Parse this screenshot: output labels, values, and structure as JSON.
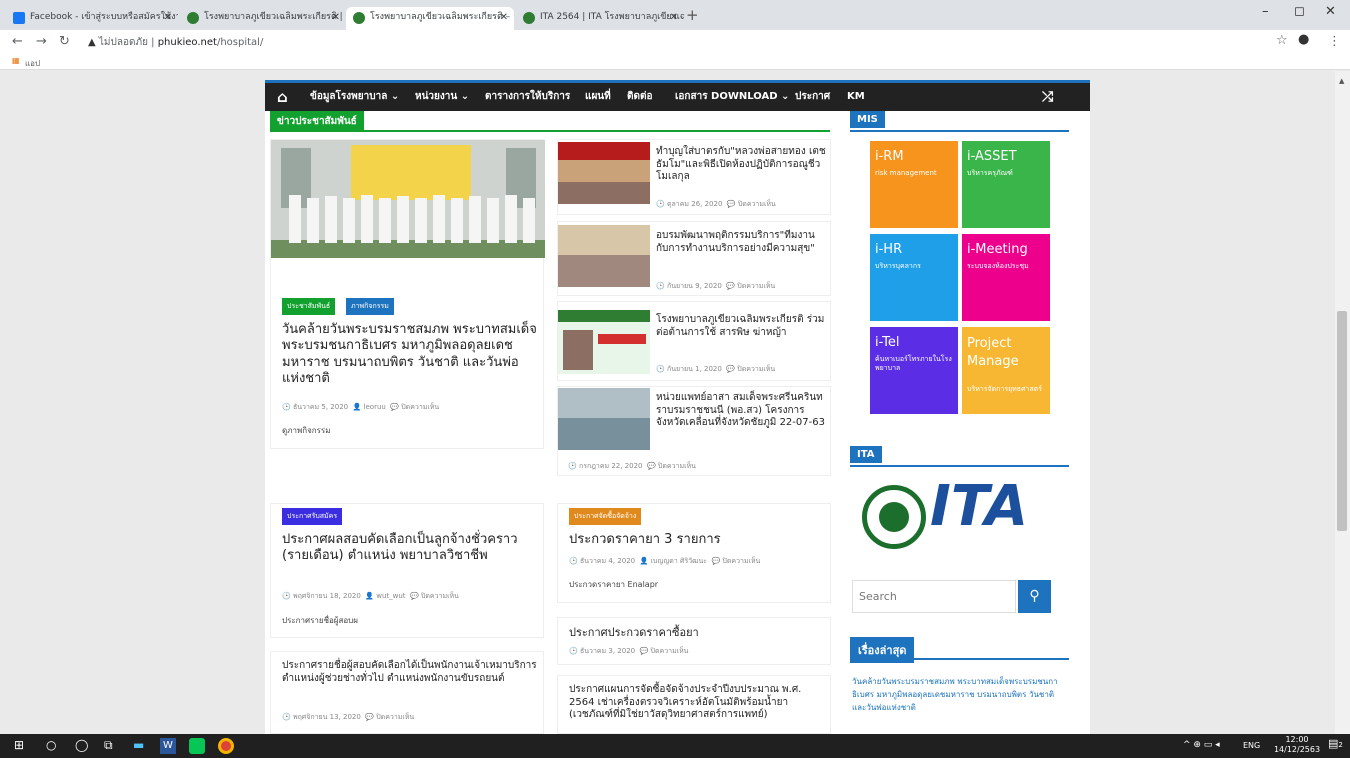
{
  "browser": {
    "tabs": [
      {
        "label": "Facebook - เข้าสู่ระบบหรือสมัครใช้งาน",
        "color": "#1877f2"
      },
      {
        "label": "โรงพยาบาลภูเขียวเฉลิมพระเกียรติ | Ho",
        "color": "#2e7d32"
      },
      {
        "label": "โรงพยาบาลภูเขียวเฉลิมพระเกียรติ – ",
        "color": "#2e7d32"
      },
      {
        "label": "ITA 2564 | ITA โรงพยาบาลภูเขียวเฉลิ",
        "color": "#2e7d32"
      }
    ],
    "new_tab": "+",
    "not_secure": "ไม่ปลอดภัย",
    "url_domain": "phukieo.net",
    "url_path": "/hospital/",
    "bookmark_apps": "แอป"
  },
  "menu": {
    "items": [
      "ข้อมูลโรงพยาบาล ⌄",
      "หน่วยงาน ⌄",
      "ตารางการให้บริการ",
      "แผนที่",
      "ติดต่อ",
      "เอกสาร DOWNLOAD ⌄",
      "ประกาศ",
      "KM"
    ]
  },
  "pr": {
    "heading": "ข่าวประชาสัมพันธ์",
    "feature": {
      "badges": [
        "ประชาสัมพันธ์",
        "ภาพกิจกรรม"
      ],
      "title": "วันคล้ายวันพระบรมราชสมภพ พระบาทสมเด็จพระบรมชนกาธิเบศร มหาภูมิพลอดุลยเดชมหาราช บรมนาถบพิตร วันชาติ และวันพ่อแห่งชาติ",
      "date": "ธันวาคม 5, 2020",
      "author": "leoruu",
      "comments": "ปิดความเห็น",
      "excerpt": "ดูภาพกิจกรรม"
    },
    "list": [
      {
        "title": "ทำบุญใส่บาตรกับ\"หลวงพ่อสายทอง เตชธัมโม\"และพิธีเปิดห้องปฏิบัติการอณูชีวโมเลกุล",
        "date": "ตุลาคม 26, 2020",
        "comments": "ปิดความเห็น"
      },
      {
        "title": "อบรมพัฒนาพฤติกรรมบริการ\"ทีมงานกับการทำงานบริการอย่างมีความสุข\"",
        "date": "กันยายน 9, 2020",
        "comments": "ปิดความเห็น"
      },
      {
        "title": "โรงพยาบาลภูเขียวเฉลิมพระเกียรติ ร่วมต่อต้านการใช้ สารพิษ ฆ่าหญ้า",
        "date": "กันยายน 1, 2020",
        "comments": "ปิดความเห็น"
      },
      {
        "title": "หน่วยแพทย์อาสา สมเด็จพระศรีนครินทราบรมราชชนนี (พอ.สว) โครงการจังหวัดเคลื่อนที่จังหวัดชัยภูมิ 22-07-63",
        "date": "กรกฎาคม 22, 2020",
        "comments": "ปิดความเห็น"
      }
    ]
  },
  "recruit": {
    "badge": "ประกาศรับสมัคร",
    "title": "ประกาศผลสอบคัดเลือกเป็นลูกจ้างชั่วคราว (รายเดือน) ตำแหน่ง พยาบาลวิชาชีพ",
    "date": "พฤศจิกายน 18, 2020",
    "author": "wut_wut",
    "comments": "ปิดความเห็น",
    "excerpt": "ประกาศรายชื่อผู้สอบผ",
    "second_title": "ประกาศรายชื่อผู้สอบคัดเลือกได้เป็นพนักงานเจ้าเหมาบริการ ตำแหน่งผู้ช่วยช่างทั่วไป ตำแหน่งพนักงานขับรถยนต์",
    "second_date": "พฤศจิกายน 13, 2020",
    "second_comments": "ปิดความเห็น"
  },
  "procure": {
    "badge": "ประกาศจัดซื้อจัดจ้าง",
    "title": "ประกวดราคายา 3 รายการ",
    "date": "ธันวาคม 4, 2020",
    "author": "เบญญดา ศิริวัฒนะ",
    "comments": "ปิดความเห็น",
    "excerpt": "ประกวดราคายา Enalapr",
    "second_title": "ประกาศประกวดราคาซื้อยา",
    "second_date": "ธันวาคม 3, 2020",
    "second_comments": "ปิดความเห็น",
    "third_title": "ประกาศแผนการจัดซื้อจัดจ้างประจำปีงบประมาณ พ.ศ. 2564 เช่าเครื่องตรวจวิเคราะห์อัตโนมัติพร้อมน้ำยา (เวชภัณฑ์ที่มิใช่ยาวัสดุวิทยาศาสตร์การแพทย์)"
  },
  "sidebar": {
    "mis_heading": "MIS",
    "tiles": [
      {
        "name": "i-RM",
        "sub": "risk management",
        "color": "#f7941d"
      },
      {
        "name": "i-ASSET",
        "sub": "บริหารครุภัณฑ์",
        "color": "#39b54a"
      },
      {
        "name": "i-HR",
        "sub": "บริหารบุคลากร",
        "color": "#1e9fe8"
      },
      {
        "name": "i-Meeting",
        "sub": "ระบบจองห้องประชุม",
        "color": "#ec008c"
      },
      {
        "name": "i-Tel",
        "sub": "ค้นหาเบอร์โทรภายในโรงพยาบาล",
        "color": "#5b2ee6"
      },
      {
        "name": "Project Manage",
        "sub": "บริหารจัดการยุทธศาสตร์",
        "color": "#f7b733"
      }
    ],
    "ita_heading": "ITA",
    "ita_text": "ITA",
    "search_placeholder": "Search",
    "recent_heading": "เรื่องล่าสุด",
    "recent_items": [
      "วันคล้ายวันพระบรมราชสมภพ พระบาทสมเด็จพระบรมชนกาธิเบศร มหาภูมิพลอดุลยเดชมหาราช บรมนาถบพิตร วันชาติ และวันพ่อแห่งชาติ"
    ]
  },
  "taskbar": {
    "lang": "ENG",
    "time": "12:00",
    "date": "14/12/2563",
    "notif": "2"
  },
  "colors": {
    "green": "#12a12f",
    "blue": "#1e73be",
    "dark": "#222222"
  }
}
